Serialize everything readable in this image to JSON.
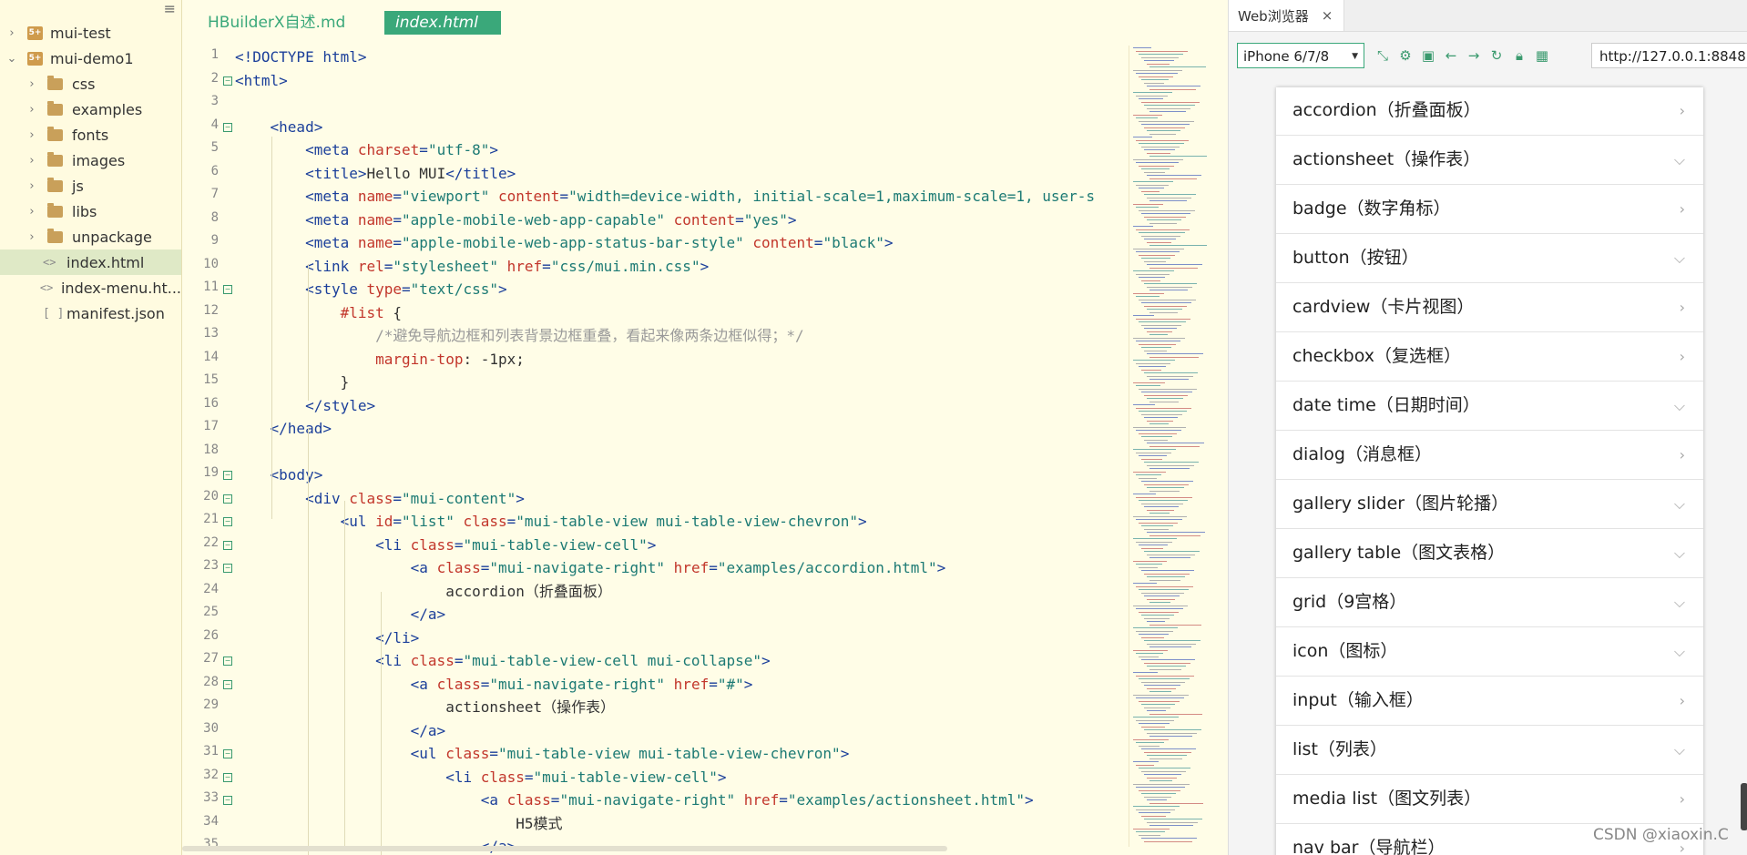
{
  "sidebar": {
    "items": [
      {
        "label": "mui-test",
        "type": "project",
        "expanded": false
      },
      {
        "label": "mui-demo1",
        "type": "project",
        "expanded": true
      },
      {
        "label": "css",
        "type": "folder"
      },
      {
        "label": "examples",
        "type": "folder"
      },
      {
        "label": "fonts",
        "type": "folder"
      },
      {
        "label": "images",
        "type": "folder"
      },
      {
        "label": "js",
        "type": "folder"
      },
      {
        "label": "libs",
        "type": "folder"
      },
      {
        "label": "unpackage",
        "type": "folder"
      },
      {
        "label": "index.html",
        "type": "file",
        "selected": true
      },
      {
        "label": "index-menu.ht...",
        "type": "file"
      },
      {
        "label": "manifest.json",
        "type": "json"
      }
    ],
    "menu_icon": "hamburger-icon"
  },
  "editor": {
    "tabs": [
      {
        "label": "HBuilderX自述.md",
        "active": false
      },
      {
        "label": "index.html",
        "active": true
      }
    ],
    "line_numbers": [
      "1",
      "2",
      "3",
      "4",
      "5",
      "6",
      "7",
      "8",
      "9",
      "10",
      "11",
      "12",
      "13",
      "14",
      "15",
      "16",
      "17",
      "18",
      "19",
      "20",
      "21",
      "22",
      "23",
      "24",
      "25",
      "26",
      "27",
      "28",
      "29",
      "30",
      "31",
      "32",
      "33",
      "34",
      "35"
    ],
    "lines": [
      [
        {
          "t": "tag",
          "v": "<!DOCTYPE html>"
        }
      ],
      [
        {
          "t": "tag",
          "v": "<html>"
        }
      ],
      [],
      [
        {
          "t": "ws",
          "v": "    "
        },
        {
          "t": "tag",
          "v": "<head>"
        }
      ],
      [
        {
          "t": "ws",
          "v": "        "
        },
        {
          "t": "tag",
          "v": "<meta "
        },
        {
          "t": "attr",
          "v": "charset"
        },
        {
          "t": "tag",
          "v": "="
        },
        {
          "t": "str",
          "v": "\"utf-8\""
        },
        {
          "t": "tag",
          "v": ">"
        }
      ],
      [
        {
          "t": "ws",
          "v": "        "
        },
        {
          "t": "tag",
          "v": "<title>"
        },
        {
          "t": "text",
          "v": "Hello MUI"
        },
        {
          "t": "tag",
          "v": "</title>"
        }
      ],
      [
        {
          "t": "ws",
          "v": "        "
        },
        {
          "t": "tag",
          "v": "<meta "
        },
        {
          "t": "attr",
          "v": "name"
        },
        {
          "t": "tag",
          "v": "="
        },
        {
          "t": "str",
          "v": "\"viewport\""
        },
        {
          "t": "tag",
          "v": " "
        },
        {
          "t": "attr",
          "v": "content"
        },
        {
          "t": "tag",
          "v": "="
        },
        {
          "t": "str",
          "v": "\"width=device-width, initial-scale=1,maximum-scale=1, user-s"
        }
      ],
      [
        {
          "t": "ws",
          "v": "        "
        },
        {
          "t": "tag",
          "v": "<meta "
        },
        {
          "t": "attr",
          "v": "name"
        },
        {
          "t": "tag",
          "v": "="
        },
        {
          "t": "str",
          "v": "\"apple-mobile-web-app-capable\""
        },
        {
          "t": "tag",
          "v": " "
        },
        {
          "t": "attr",
          "v": "content"
        },
        {
          "t": "tag",
          "v": "="
        },
        {
          "t": "str",
          "v": "\"yes\""
        },
        {
          "t": "tag",
          "v": ">"
        }
      ],
      [
        {
          "t": "ws",
          "v": "        "
        },
        {
          "t": "tag",
          "v": "<meta "
        },
        {
          "t": "attr",
          "v": "name"
        },
        {
          "t": "tag",
          "v": "="
        },
        {
          "t": "str",
          "v": "\"apple-mobile-web-app-status-bar-style\""
        },
        {
          "t": "tag",
          "v": " "
        },
        {
          "t": "attr",
          "v": "content"
        },
        {
          "t": "tag",
          "v": "="
        },
        {
          "t": "str",
          "v": "\"black\""
        },
        {
          "t": "tag",
          "v": ">"
        }
      ],
      [
        {
          "t": "ws",
          "v": "        "
        },
        {
          "t": "tag",
          "v": "<link "
        },
        {
          "t": "attr",
          "v": "rel"
        },
        {
          "t": "tag",
          "v": "="
        },
        {
          "t": "str",
          "v": "\"stylesheet\""
        },
        {
          "t": "tag",
          "v": " "
        },
        {
          "t": "attr",
          "v": "href"
        },
        {
          "t": "tag",
          "v": "="
        },
        {
          "t": "str",
          "v": "\"css/mui.min.css\""
        },
        {
          "t": "tag",
          "v": ">"
        }
      ],
      [
        {
          "t": "ws",
          "v": "        "
        },
        {
          "t": "tag",
          "v": "<style "
        },
        {
          "t": "attr",
          "v": "type"
        },
        {
          "t": "tag",
          "v": "="
        },
        {
          "t": "str",
          "v": "\"text/css\""
        },
        {
          "t": "tag",
          "v": ">"
        }
      ],
      [
        {
          "t": "ws",
          "v": "            "
        },
        {
          "t": "sel",
          "v": "#list"
        },
        {
          "t": "text",
          "v": " {"
        }
      ],
      [
        {
          "t": "ws",
          "v": "                "
        },
        {
          "t": "comment",
          "v": "/*避免导航边框和列表背景边框重叠，看起来像两条边框似得；*/"
        }
      ],
      [
        {
          "t": "ws",
          "v": "                "
        },
        {
          "t": "sel",
          "v": "margin-top"
        },
        {
          "t": "text",
          "v": ": -1px;"
        }
      ],
      [
        {
          "t": "ws",
          "v": "            "
        },
        {
          "t": "text",
          "v": "}"
        }
      ],
      [
        {
          "t": "ws",
          "v": "        "
        },
        {
          "t": "tag",
          "v": "</style>"
        }
      ],
      [
        {
          "t": "ws",
          "v": "    "
        },
        {
          "t": "tag",
          "v": "</head>"
        }
      ],
      [],
      [
        {
          "t": "ws",
          "v": "    "
        },
        {
          "t": "tag",
          "v": "<body>"
        }
      ],
      [
        {
          "t": "ws",
          "v": "        "
        },
        {
          "t": "tag",
          "v": "<div "
        },
        {
          "t": "attr",
          "v": "class"
        },
        {
          "t": "tag",
          "v": "="
        },
        {
          "t": "str",
          "v": "\"mui-content\""
        },
        {
          "t": "tag",
          "v": ">"
        }
      ],
      [
        {
          "t": "ws",
          "v": "            "
        },
        {
          "t": "tag",
          "v": "<ul "
        },
        {
          "t": "attr",
          "v": "id"
        },
        {
          "t": "tag",
          "v": "="
        },
        {
          "t": "str",
          "v": "\"list\""
        },
        {
          "t": "tag",
          "v": " "
        },
        {
          "t": "attr",
          "v": "class"
        },
        {
          "t": "tag",
          "v": "="
        },
        {
          "t": "str",
          "v": "\"mui-table-view mui-table-view-chevron\""
        },
        {
          "t": "tag",
          "v": ">"
        }
      ],
      [
        {
          "t": "ws",
          "v": "                "
        },
        {
          "t": "tag",
          "v": "<li "
        },
        {
          "t": "attr",
          "v": "class"
        },
        {
          "t": "tag",
          "v": "="
        },
        {
          "t": "str",
          "v": "\"mui-table-view-cell\""
        },
        {
          "t": "tag",
          "v": ">"
        }
      ],
      [
        {
          "t": "ws",
          "v": "                    "
        },
        {
          "t": "tag",
          "v": "<a "
        },
        {
          "t": "attr",
          "v": "class"
        },
        {
          "t": "tag",
          "v": "="
        },
        {
          "t": "str",
          "v": "\"mui-navigate-right\""
        },
        {
          "t": "tag",
          "v": " "
        },
        {
          "t": "attr",
          "v": "href"
        },
        {
          "t": "tag",
          "v": "="
        },
        {
          "t": "str",
          "v": "\"examples/accordion.html\""
        },
        {
          "t": "tag",
          "v": ">"
        }
      ],
      [
        {
          "t": "ws",
          "v": "                        "
        },
        {
          "t": "text",
          "v": "accordion（折叠面板）"
        }
      ],
      [
        {
          "t": "ws",
          "v": "                    "
        },
        {
          "t": "tag",
          "v": "</a>"
        }
      ],
      [
        {
          "t": "ws",
          "v": "                "
        },
        {
          "t": "tag",
          "v": "</li>"
        }
      ],
      [
        {
          "t": "ws",
          "v": "                "
        },
        {
          "t": "tag",
          "v": "<li "
        },
        {
          "t": "attr",
          "v": "class"
        },
        {
          "t": "tag",
          "v": "="
        },
        {
          "t": "str",
          "v": "\"mui-table-view-cell mui-collapse\""
        },
        {
          "t": "tag",
          "v": ">"
        }
      ],
      [
        {
          "t": "ws",
          "v": "                    "
        },
        {
          "t": "tag",
          "v": "<a "
        },
        {
          "t": "attr",
          "v": "class"
        },
        {
          "t": "tag",
          "v": "="
        },
        {
          "t": "str",
          "v": "\"mui-navigate-right\""
        },
        {
          "t": "tag",
          "v": " "
        },
        {
          "t": "attr",
          "v": "href"
        },
        {
          "t": "tag",
          "v": "="
        },
        {
          "t": "str",
          "v": "\"#\""
        },
        {
          "t": "tag",
          "v": ">"
        }
      ],
      [
        {
          "t": "ws",
          "v": "                        "
        },
        {
          "t": "text",
          "v": "actionsheet（操作表）"
        }
      ],
      [
        {
          "t": "ws",
          "v": "                    "
        },
        {
          "t": "tag",
          "v": "</a>"
        }
      ],
      [
        {
          "t": "ws",
          "v": "                    "
        },
        {
          "t": "tag",
          "v": "<ul "
        },
        {
          "t": "attr",
          "v": "class"
        },
        {
          "t": "tag",
          "v": "="
        },
        {
          "t": "str",
          "v": "\"mui-table-view mui-table-view-chevron\""
        },
        {
          "t": "tag",
          "v": ">"
        }
      ],
      [
        {
          "t": "ws",
          "v": "                        "
        },
        {
          "t": "tag",
          "v": "<li "
        },
        {
          "t": "attr",
          "v": "class"
        },
        {
          "t": "tag",
          "v": "="
        },
        {
          "t": "str",
          "v": "\"mui-table-view-cell\""
        },
        {
          "t": "tag",
          "v": ">"
        }
      ],
      [
        {
          "t": "ws",
          "v": "                            "
        },
        {
          "t": "tag",
          "v": "<a "
        },
        {
          "t": "attr",
          "v": "class"
        },
        {
          "t": "tag",
          "v": "="
        },
        {
          "t": "str",
          "v": "\"mui-navigate-right\""
        },
        {
          "t": "tag",
          "v": " "
        },
        {
          "t": "attr",
          "v": "href"
        },
        {
          "t": "tag",
          "v": "="
        },
        {
          "t": "str",
          "v": "\"examples/actionsheet.html\""
        },
        {
          "t": "tag",
          "v": ">"
        }
      ],
      [
        {
          "t": "ws",
          "v": "                                "
        },
        {
          "t": "text",
          "v": "H5模式"
        }
      ],
      [
        {
          "t": "ws",
          "v": "                            "
        },
        {
          "t": "tag",
          "v": "</a>"
        }
      ]
    ],
    "foldable_lines": [
      2,
      4,
      11,
      19,
      20,
      21,
      22,
      23,
      27,
      28,
      31,
      32,
      33
    ]
  },
  "browser": {
    "tab_label": "Web浏览器",
    "tab_close": "×",
    "device": "iPhone 6/7/8",
    "toolbar_icons": [
      "rotate-icon",
      "settings-icon",
      "screenshot-icon",
      "back-arrow-icon",
      "forward-arrow-icon",
      "refresh-icon",
      "lock-icon",
      "qrcode-icon"
    ],
    "url": "http://127.0.0.1:8848",
    "list": [
      {
        "label": "accordion（折叠面板）",
        "chevron": "right"
      },
      {
        "label": "actionsheet（操作表）",
        "chevron": "down"
      },
      {
        "label": "badge（数字角标）",
        "chevron": "right"
      },
      {
        "label": "button（按钮）",
        "chevron": "down"
      },
      {
        "label": "cardview（卡片视图）",
        "chevron": "right"
      },
      {
        "label": "checkbox（复选框）",
        "chevron": "right"
      },
      {
        "label": "date time（日期时间）",
        "chevron": "down"
      },
      {
        "label": "dialog（消息框）",
        "chevron": "right"
      },
      {
        "label": "gallery slider（图片轮播）",
        "chevron": "down"
      },
      {
        "label": "gallery table（图文表格）",
        "chevron": "down"
      },
      {
        "label": "grid（9宫格）",
        "chevron": "down"
      },
      {
        "label": "icon（图标）",
        "chevron": "down"
      },
      {
        "label": "input（输入框）",
        "chevron": "right"
      },
      {
        "label": "list（列表）",
        "chevron": "down"
      },
      {
        "label": "media list（图文列表）",
        "chevron": "right"
      },
      {
        "label": "nav bar（导航栏）",
        "chevron": "right"
      }
    ],
    "watermark": "CSDN @xiaoxin.C"
  },
  "colors": {
    "background": "#fffde7",
    "accent": "#3aa87a",
    "tag": "#1b3f9a",
    "attr": "#c2362b",
    "string": "#1c7a74",
    "comment": "#9a9a9a"
  }
}
